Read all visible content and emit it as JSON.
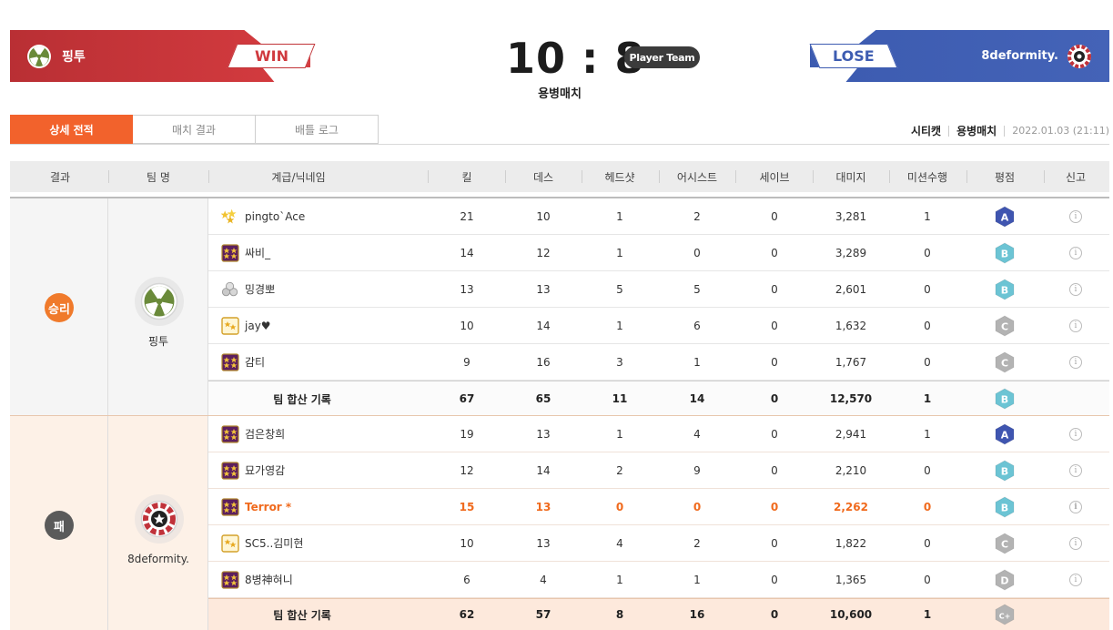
{
  "header": {
    "left_team": {
      "name": "핑투",
      "result": "WIN"
    },
    "right_team": {
      "name": "8deformity.",
      "result": "LOSE"
    },
    "score": "10 : 8",
    "player_team_badge": "Player Team",
    "match_type": "용병매치"
  },
  "tabs": [
    {
      "label": "상세 전적",
      "active": true
    },
    {
      "label": "매치 결과",
      "active": false
    },
    {
      "label": "배틀 로그",
      "active": false
    }
  ],
  "meta": {
    "map": "시티캣",
    "mode": "용병매치",
    "datetime": "2022.01.03 (21:11)"
  },
  "columns": [
    "결과",
    "팀 명",
    "계급/닉네임",
    "킬",
    "데스",
    "헤드샷",
    "어시스트",
    "세이브",
    "대미지",
    "미션수행",
    "평점",
    "신고"
  ],
  "teams": [
    {
      "result_label": "승리",
      "name": "핑투",
      "players": [
        {
          "rank": "star-gold",
          "nick": "pingto`Ace",
          "kill": "21",
          "death": "10",
          "hs": "1",
          "assist": "2",
          "save": "0",
          "damage": "3,281",
          "mission": "1",
          "grade": "A",
          "me": false
        },
        {
          "rank": "star-purple",
          "nick": "싸비_",
          "kill": "14",
          "death": "12",
          "hs": "1",
          "assist": "0",
          "save": "0",
          "damage": "3,289",
          "mission": "0",
          "grade": "B",
          "me": false
        },
        {
          "rank": "gray",
          "nick": "밍경뽀",
          "kill": "13",
          "death": "13",
          "hs": "5",
          "assist": "5",
          "save": "0",
          "damage": "2,601",
          "mission": "0",
          "grade": "B",
          "me": false
        },
        {
          "rank": "shield-gold",
          "nick": "jay♥",
          "kill": "10",
          "death": "14",
          "hs": "1",
          "assist": "6",
          "save": "0",
          "damage": "1,632",
          "mission": "0",
          "grade": "C",
          "me": false
        },
        {
          "rank": "star-purple",
          "nick": "감티",
          "kill": "9",
          "death": "16",
          "hs": "3",
          "assist": "1",
          "save": "0",
          "damage": "1,767",
          "mission": "0",
          "grade": "C",
          "me": false
        }
      ],
      "total": {
        "label": "팀 합산 기록",
        "kill": "67",
        "death": "65",
        "hs": "11",
        "assist": "14",
        "save": "0",
        "damage": "12,570",
        "mission": "1",
        "grade": "B"
      }
    },
    {
      "result_label": "패",
      "name": "8deformity.",
      "players": [
        {
          "rank": "star-purple",
          "nick": "검은창희",
          "kill": "19",
          "death": "13",
          "hs": "1",
          "assist": "4",
          "save": "0",
          "damage": "2,941",
          "mission": "1",
          "grade": "A",
          "me": false
        },
        {
          "rank": "star-purple",
          "nick": "묘가영감",
          "kill": "12",
          "death": "14",
          "hs": "2",
          "assist": "9",
          "save": "0",
          "damage": "2,210",
          "mission": "0",
          "grade": "B",
          "me": false
        },
        {
          "rank": "star-purple",
          "nick": "Terror *",
          "kill": "15",
          "death": "13",
          "hs": "0",
          "assist": "0",
          "save": "0",
          "damage": "2,262",
          "mission": "0",
          "grade": "B",
          "me": true
        },
        {
          "rank": "shield-gold",
          "nick": "SC5..김미현",
          "kill": "10",
          "death": "13",
          "hs": "4",
          "assist": "2",
          "save": "0",
          "damage": "1,822",
          "mission": "0",
          "grade": "C",
          "me": false
        },
        {
          "rank": "star-purple",
          "nick": "8병神혀니",
          "kill": "6",
          "death": "4",
          "hs": "1",
          "assist": "1",
          "save": "0",
          "damage": "1,365",
          "mission": "0",
          "grade": "D",
          "me": false
        }
      ],
      "total": {
        "label": "팀 합산 기록",
        "kill": "62",
        "death": "57",
        "hs": "8",
        "assist": "16",
        "save": "0",
        "damage": "10,600",
        "mission": "1",
        "grade": "C+"
      }
    }
  ],
  "colors": {
    "win_red": "#c8363a",
    "lose_blue": "#3f5fb3",
    "accent_orange": "#f2622c",
    "grade_A": "#3f55b0",
    "grade_B": "#6cc4d4",
    "grade_C": "#b3b3b3",
    "grade_D": "#b3b3b3"
  },
  "icons": {
    "team_emblem_left": "radiation-emblem-icon",
    "team_emblem_right": "red-ring-emblem-icon",
    "report": "info-icon"
  }
}
